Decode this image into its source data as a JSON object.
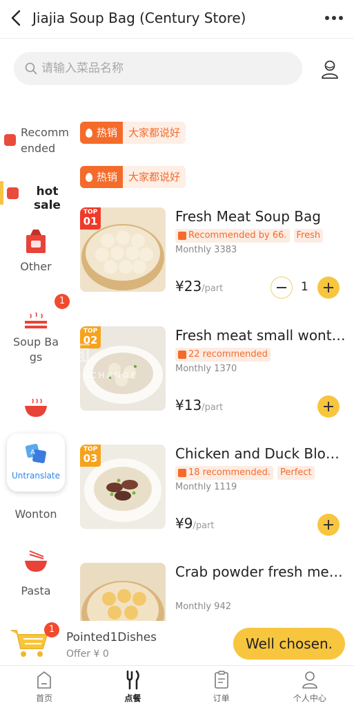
{
  "header": {
    "title": "Jiajia Soup Bag (Century Store)"
  },
  "search": {
    "placeholder": "请输入菜品名称"
  },
  "sidebar": {
    "items": [
      {
        "label": "Recomm ended"
      },
      {
        "label": "hot sale"
      },
      {
        "label": "Other"
      },
      {
        "label": "Soup Ba gs"
      },
      {
        "label": ""
      },
      {
        "label": "Wonton"
      },
      {
        "label": "Pasta"
      }
    ],
    "badge": "1"
  },
  "translate_widget": {
    "label": "Untranslate"
  },
  "tag_rows": [
    {
      "hot": "热销",
      "text": "大家都说好"
    },
    {
      "hot": "热销",
      "text": "大家都说好"
    }
  ],
  "products": [
    {
      "rank_top": "TOP",
      "rank_num": "01",
      "name": "Fresh Meat Soup Bag",
      "badges": [
        "Recommended by 66.",
        "Fresh"
      ],
      "monthly": "Monthly 3383",
      "price": "¥23",
      "unit": "/part",
      "quantity": "1"
    },
    {
      "rank_top": "TOP",
      "rank_num": "02",
      "name": "Fresh meat small wont…",
      "badges": [
        "22 recommended"
      ],
      "monthly": "Monthly 1370",
      "price": "¥13",
      "unit": "/part"
    },
    {
      "rank_top": "TOP",
      "rank_num": "03",
      "name": "Chicken and Duck Blo…",
      "badges": [
        "18 recommended.",
        "Perfect"
      ],
      "monthly": "Monthly 1119",
      "price": "¥9",
      "unit": "/part"
    },
    {
      "name": "Crab powder fresh me…",
      "monthly": "Monthly 942"
    }
  ],
  "watermark": {
    "line1": "面",
    "line2": "EXCHANGE"
  },
  "cart": {
    "badge": "1",
    "title": "Pointed1Dishes",
    "offer": "Offer ¥ 0",
    "button": "Well chosen."
  },
  "tabbar": {
    "tabs": [
      {
        "label": "首页"
      },
      {
        "label": "点餐"
      },
      {
        "label": "订单"
      },
      {
        "label": "个人中心"
      }
    ]
  },
  "colors": {
    "accent_yellow": "#f7c63e",
    "hot_orange": "#f46b2a",
    "rank_red": "#ef3a2a",
    "rank_orange": "#f7a21c",
    "badge_red": "#f24a2f"
  }
}
